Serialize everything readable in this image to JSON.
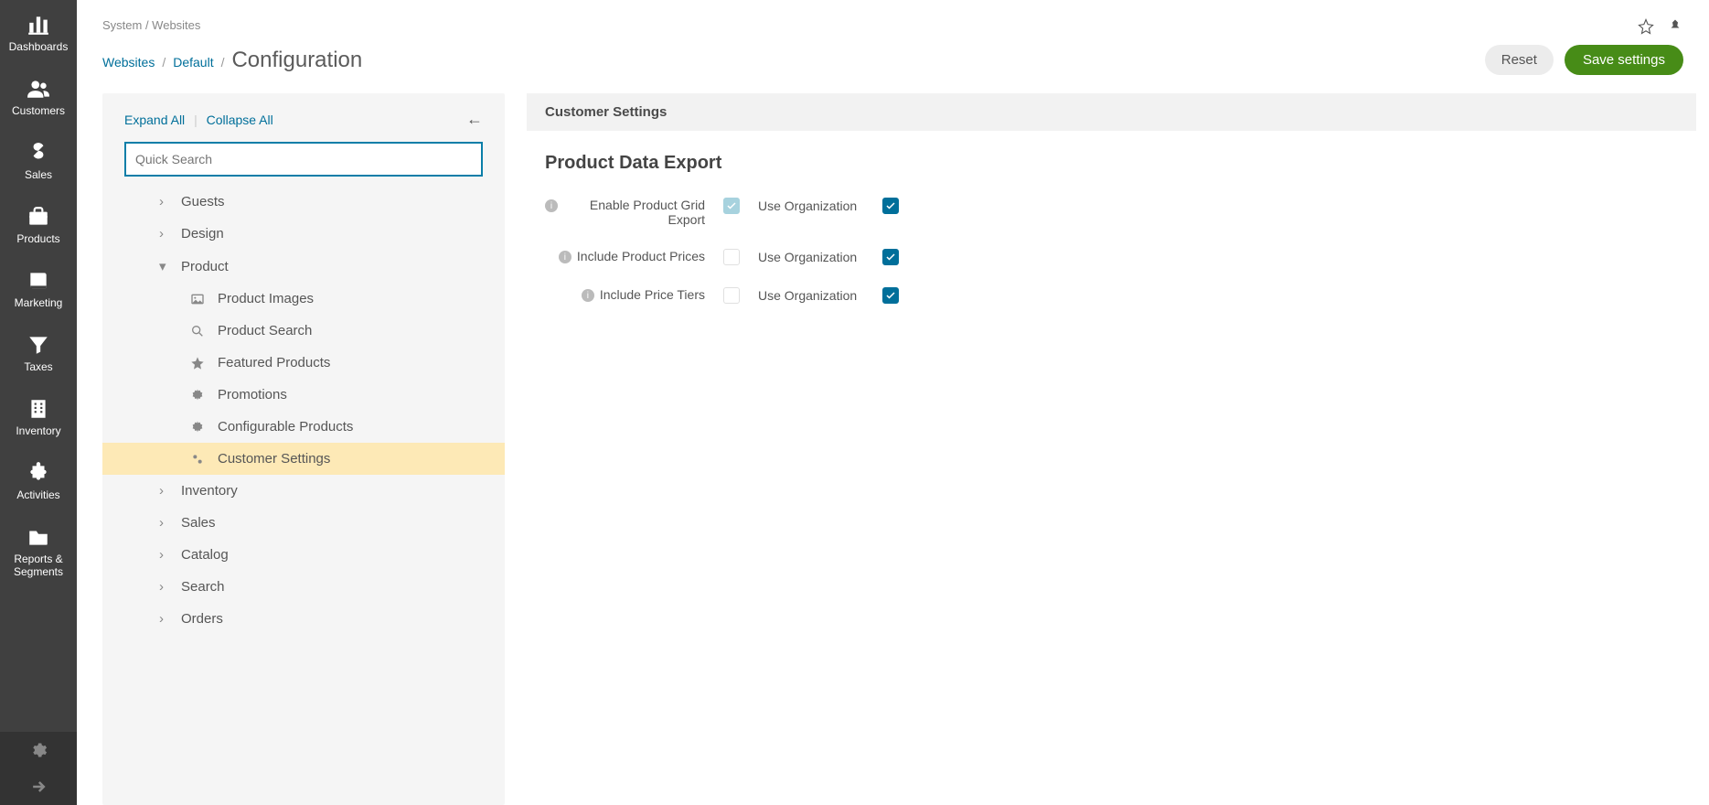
{
  "sidebar": {
    "items": [
      {
        "label": "Dashboards",
        "key": "dashboards"
      },
      {
        "label": "Customers",
        "key": "customers"
      },
      {
        "label": "Sales",
        "key": "sales"
      },
      {
        "label": "Products",
        "key": "products"
      },
      {
        "label": "Marketing",
        "key": "marketing"
      },
      {
        "label": "Taxes",
        "key": "taxes"
      },
      {
        "label": "Inventory",
        "key": "inventory"
      },
      {
        "label": "Activities",
        "key": "activities"
      },
      {
        "label": "Reports &\nSegments",
        "key": "reports"
      }
    ]
  },
  "breadcrumb_top": "System / Websites",
  "page_breadcrumb": {
    "link1": "Websites",
    "link2": "Default",
    "title": "Configuration"
  },
  "buttons": {
    "reset": "Reset",
    "save": "Save settings"
  },
  "tree": {
    "expand": "Expand All",
    "collapse": "Collapse All",
    "search_placeholder": "Quick Search",
    "items": [
      {
        "label": "Guests",
        "level": 1,
        "chev": "right"
      },
      {
        "label": "Design",
        "level": 1,
        "chev": "right"
      },
      {
        "label": "Product",
        "level": 1,
        "chev": "down"
      },
      {
        "label": "Product Images",
        "level": 2,
        "icon": "image"
      },
      {
        "label": "Product Search",
        "level": 2,
        "icon": "search"
      },
      {
        "label": "Featured Products",
        "level": 2,
        "icon": "star"
      },
      {
        "label": "Promotions",
        "level": 2,
        "icon": "gear"
      },
      {
        "label": "Configurable Products",
        "level": 2,
        "icon": "gear"
      },
      {
        "label": "Customer Settings",
        "level": 2,
        "icon": "gears",
        "active": true
      },
      {
        "label": "Inventory",
        "level": 1,
        "chev": "right"
      },
      {
        "label": "Sales",
        "level": 1,
        "chev": "right"
      },
      {
        "label": "Catalog",
        "level": 1,
        "chev": "right"
      },
      {
        "label": "Search",
        "level": 1,
        "chev": "right"
      },
      {
        "label": "Orders",
        "level": 1,
        "chev": "right"
      }
    ]
  },
  "settings": {
    "group": "Customer Settings",
    "section": "Product Data Export",
    "use_org": "Use Organization",
    "rows": [
      {
        "label": "Enable Product Grid Export",
        "checkbox": "checked-disabled",
        "org": true
      },
      {
        "label": "Include Product Prices",
        "checkbox": "unchecked",
        "org": true
      },
      {
        "label": "Include Price Tiers",
        "checkbox": "unchecked",
        "org": true
      }
    ]
  }
}
